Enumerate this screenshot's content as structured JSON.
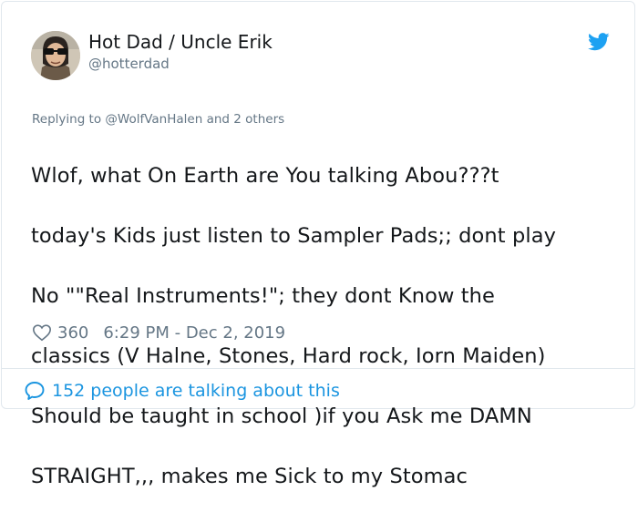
{
  "tweet": {
    "author_name": "Hot Dad / Uncle Erik",
    "author_handle": "@hotterdad",
    "reply_prefix": "Replying to",
    "reply_to": "@WolfVanHalen",
    "reply_suffix": "and 2 others",
    "body_lines": [
      "Wlof,  what On Earth are You talking Abou???t",
      "today's Kids just listen to Sampler Pads;; dont play",
      "No \"\"Real Instruments!\"; they dont Know the",
      "classics (V Halne, Stones, Hard rock, Iorn Maiden)",
      "Should be taught in school )if you Ask me DAMN",
      "STRAIGHT,,, makes me Sick to my Stomac"
    ],
    "likes": "360",
    "timestamp": "6:29 PM - Dec 2, 2019",
    "conversation": "152 people are talking about this"
  },
  "icons": {
    "logo": "twitter-bird-icon",
    "like": "heart-icon",
    "conversation": "speech-bubble-icon"
  },
  "colors": {
    "brand": "#1da1f2",
    "link": "#1b95e0",
    "muted": "#657786",
    "text": "#14171a",
    "border": "#e1e8ed"
  }
}
